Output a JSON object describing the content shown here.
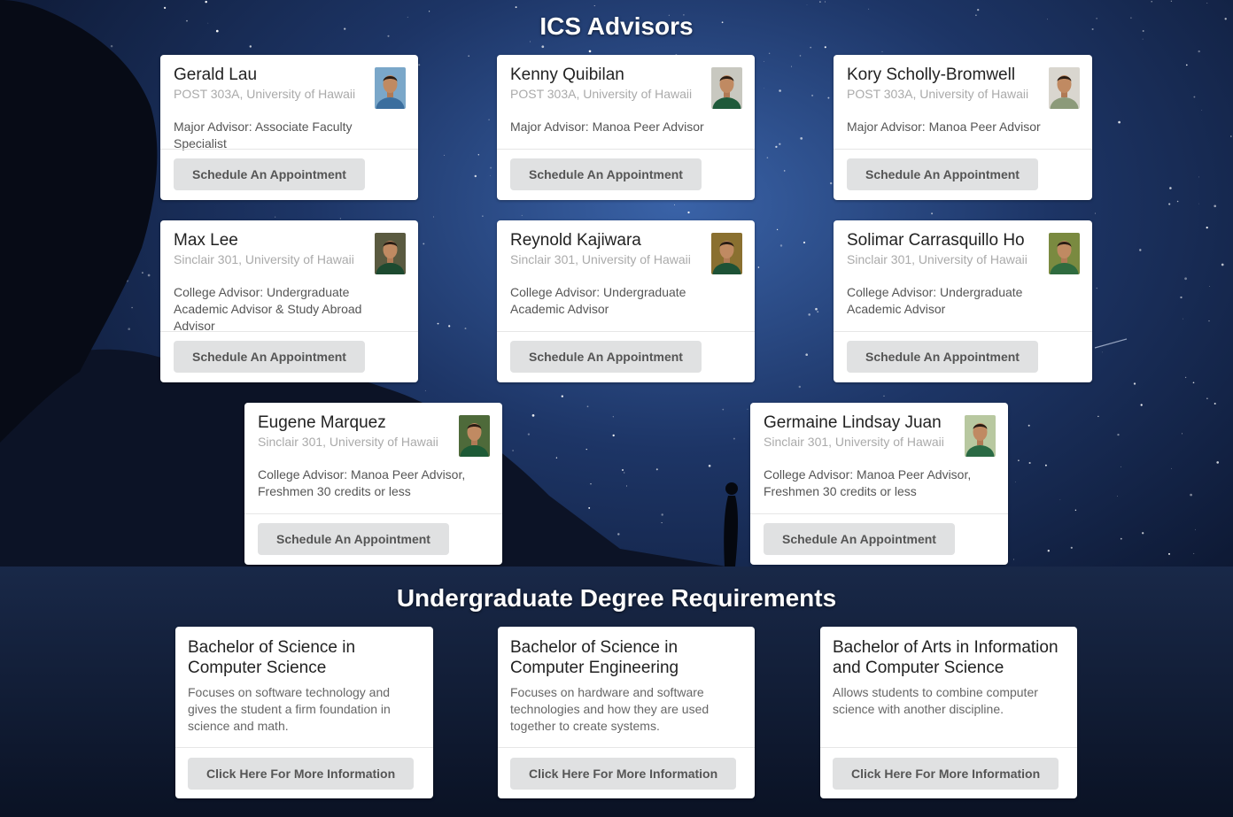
{
  "page": {
    "advisors_heading": "ICS Advisors",
    "degrees_heading": "Undergraduate Degree Requirements"
  },
  "advisors": [
    {
      "name": "Gerald Lau",
      "location": "POST 303A, University of Hawaii",
      "role": "Major Advisor: Associate Faculty Specialist",
      "button": "Schedule An Appointment",
      "photo_bg": "#7aa7c9",
      "photo_shirt": "#3b6e9e"
    },
    {
      "name": "Kenny Quibilan",
      "location": "POST 303A, University of Hawaii",
      "role": "Major Advisor: Manoa Peer Advisor",
      "button": "Schedule An Appointment",
      "photo_bg": "#c8c8c0",
      "photo_shirt": "#1f5a3a"
    },
    {
      "name": "Kory Scholly-Bromwell",
      "location": "POST 303A, University of Hawaii",
      "role": "Major Advisor: Manoa Peer Advisor",
      "button": "Schedule An Appointment",
      "photo_bg": "#d9d6cf",
      "photo_shirt": "#8c9a7a"
    },
    {
      "name": "Max Lee",
      "location": "Sinclair 301, University of Hawaii",
      "role": "College Advisor: Undergraduate Academic Advisor & Study Abroad Advisor",
      "button": "Schedule An Appointment",
      "photo_bg": "#5a5a40",
      "photo_shirt": "#1d4a30"
    },
    {
      "name": "Reynold Kajiwara",
      "location": "Sinclair 301, University of Hawaii",
      "role": "College Advisor: Undergraduate Academic Advisor",
      "button": "Schedule An Appointment",
      "photo_bg": "#8a7030",
      "photo_shirt": "#1d5236"
    },
    {
      "name": "Solimar Carrasquillo Ho",
      "location": "Sinclair 301, University of Hawaii",
      "role": "College Advisor: Undergraduate Academic Advisor",
      "button": "Schedule An Appointment",
      "photo_bg": "#7a8a40",
      "photo_shirt": "#2f6b3f"
    },
    {
      "name": "Eugene Marquez",
      "location": "Sinclair 301, University of Hawaii",
      "role": "College Advisor: Manoa Peer Advisor, Freshmen 30 credits or less",
      "button": "Schedule An Appointment",
      "photo_bg": "#4e6a3a",
      "photo_shirt": "#1d5a36"
    },
    {
      "name": "Germaine Lindsay Juan",
      "location": "Sinclair 301, University of Hawaii",
      "role": "College Advisor: Manoa Peer Advisor, Freshmen 30 credits or less",
      "button": "Schedule An Appointment",
      "photo_bg": "#b8c8a0",
      "photo_shirt": "#2a6a44"
    }
  ],
  "degrees": [
    {
      "title": "Bachelor of Science in Computer Science",
      "description": "Focuses on software technology and gives the student a firm foundation in science and math.",
      "button": "Click Here For More Information"
    },
    {
      "title": "Bachelor of Science in Computer Engineering",
      "description": "Focuses on hardware and software technologies and how they are used together to create systems.",
      "button": "Click Here For More Information"
    },
    {
      "title": "Bachelor of Arts in Information and Computer Science",
      "description": "Allows students to combine computer science with another discipline.",
      "button": "Click Here For More Information"
    }
  ]
}
